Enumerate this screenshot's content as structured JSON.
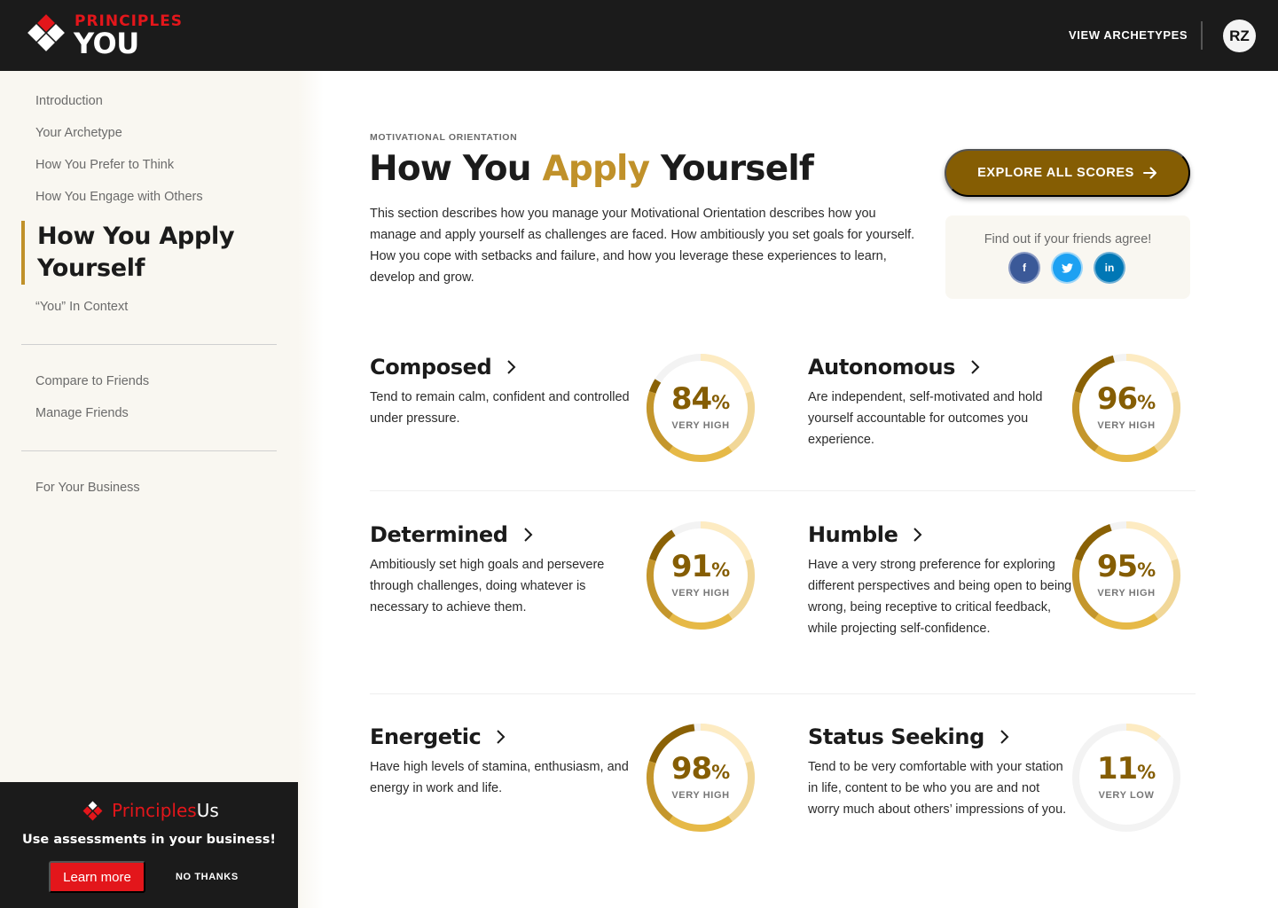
{
  "header": {
    "logo_top": "PRINCIPLES",
    "logo_bottom": "YOU",
    "view_archetypes": "VIEW ARCHETYPES",
    "avatar_initials": "RZ"
  },
  "sidebar": {
    "items": [
      {
        "label": "Introduction"
      },
      {
        "label": "Your Archetype"
      },
      {
        "label": "How You Prefer to Think"
      },
      {
        "label": "How You Engage with Others"
      },
      {
        "label": "How You Apply Yourself",
        "line1": "How You Apply",
        "line2": "Yourself",
        "active": true
      },
      {
        "label": "“You” In Context"
      }
    ],
    "friends_items": [
      {
        "label": "Compare to Friends"
      },
      {
        "label": "Manage Friends"
      }
    ],
    "business_items": [
      {
        "label": "For Your Business"
      }
    ]
  },
  "promo": {
    "brand_red": "Principles",
    "brand_white": "Us",
    "tagline": "Use assessments in your business!",
    "learn_more": "Learn more",
    "no_thanks": "NO THANKS"
  },
  "main": {
    "eyebrow": "MOTIVATIONAL ORIENTATION",
    "title_prefix": "How You ",
    "title_accent": "Apply",
    "title_suffix": " Yourself",
    "intro": "This section describes how you manage your Motivational Orientation describes how you manage and apply yourself as challenges are faced. How ambitiously you set goals for yourself. How you cope with setbacks and failure, and how you leverage these experiences to learn, develop and grow.",
    "explore_button": "EXPLORE ALL SCORES",
    "share": {
      "title": "Find out if your friends agree!",
      "networks": [
        {
          "name": "facebook",
          "glyph": "f",
          "color": "#3b5998"
        },
        {
          "name": "twitter",
          "glyph": "🐦",
          "color": "#1da1f2"
        },
        {
          "name": "linkedin",
          "glyph": "in",
          "color": "#0077b5"
        }
      ]
    },
    "traits": [
      {
        "name": "Composed",
        "description": "Tend to remain calm, confident and controlled under pressure.",
        "score": 84,
        "level": "VERY HIGH"
      },
      {
        "name": "Autonomous",
        "description": "Are independent, self-motivated and hold yourself accountable for outcomes you experience.",
        "score": 96,
        "level": "VERY HIGH"
      },
      {
        "name": "Determined",
        "description": "Ambitiously set high goals and persevere through challenges, doing whatever is necessary to achieve them.",
        "score": 91,
        "level": "VERY HIGH"
      },
      {
        "name": "Humble",
        "description": "Have a very strong preference for exploring different perspectives and being open to being wrong, being receptive to critical feedback, while projecting self-confidence.",
        "score": 95,
        "level": "VERY HIGH"
      },
      {
        "name": "Energetic",
        "description": "Have high levels of stamina, enthusiasm, and energy in work and life.",
        "score": 98,
        "level": "VERY HIGH"
      },
      {
        "name": "Status Seeking",
        "description": "Tend to be very comfortable with your station in life, content to be who you are and not worry much about others’ impressions of you.",
        "score": 11,
        "level": "VERY LOW"
      }
    ]
  },
  "colors": {
    "brand_red": "#e3161b",
    "accent_gold": "#c0912a",
    "button_brown": "#855d03",
    "ring_segments": [
      "#fdebc2",
      "#f1d798",
      "#e6b947",
      "#c4962c",
      "#8a6105"
    ],
    "ring_track": "#f3f3f3"
  }
}
